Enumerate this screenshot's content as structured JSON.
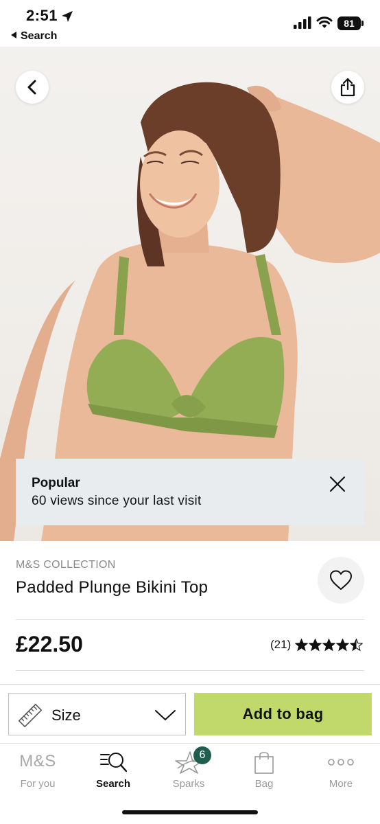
{
  "status_bar": {
    "time": "2:51",
    "back_app_label": "Search",
    "battery_level": "81"
  },
  "hero": {
    "image_icon": "product-photo",
    "back_icon": "chevron-left-icon",
    "share_icon": "share-icon"
  },
  "popular_banner": {
    "title": "Popular",
    "subtitle": "60 views since your last visit"
  },
  "product": {
    "brand": "M&S COLLECTION",
    "name": "Padded Plunge Bikini Top",
    "price": "£22.50",
    "rating_count": "(21)",
    "rating_value": 4.5,
    "rating_max": 5
  },
  "actions": {
    "size_label": "Size",
    "add_to_bag_label": "Add to bag",
    "accent_color": "#c0d96a"
  },
  "tab_bar": {
    "items": [
      {
        "label": "For you",
        "icon": "ms-logo",
        "logo_text": "M&S"
      },
      {
        "label": "Search",
        "icon": "search-list-icon"
      },
      {
        "label": "Sparks",
        "icon": "sparks-star-icon",
        "badge": "6"
      },
      {
        "label": "Bag",
        "icon": "bag-icon"
      },
      {
        "label": "More",
        "icon": "more-dots-icon"
      }
    ],
    "active": "Search"
  }
}
